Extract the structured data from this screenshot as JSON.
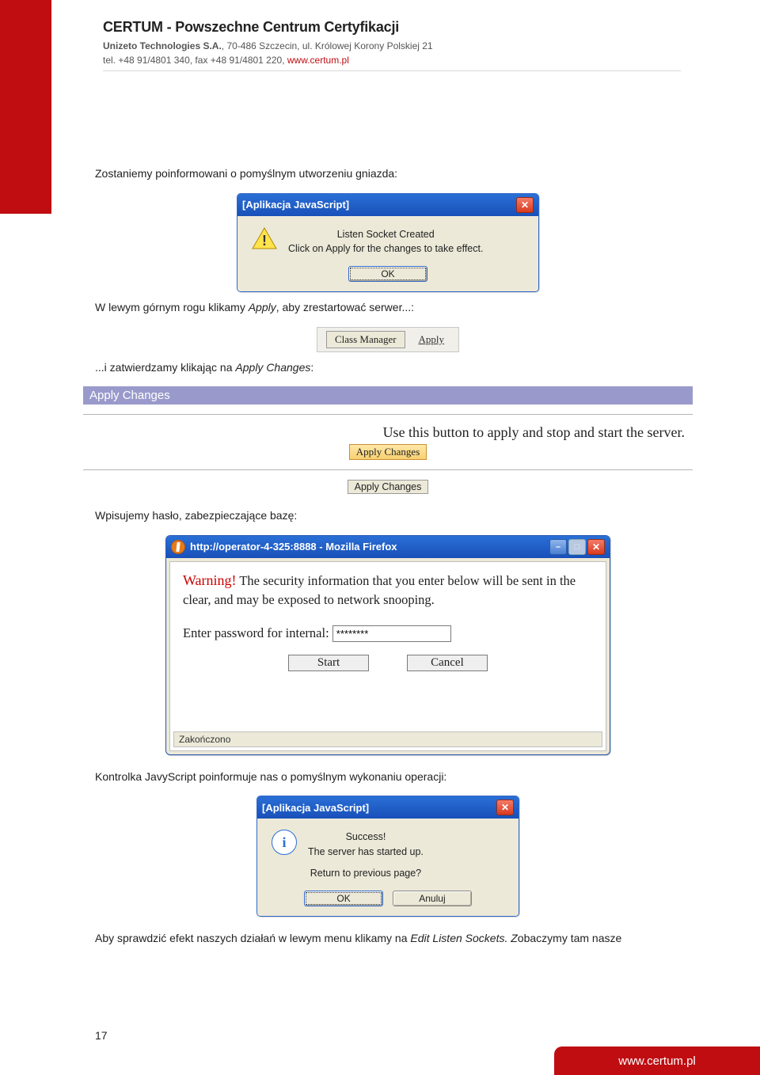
{
  "header": {
    "title": "CERTUM - Powszechne Centrum Certyfikacji",
    "line1_a": "Unizeto Technologies S.A.",
    "line1_b": ", 70-486 Szczecin, ul. Królowej Korony Polskiej 21",
    "line2_a": "tel. +48 91/4801 340, fax +48 91/4801 220, ",
    "line2_link": "www.certum.pl"
  },
  "body": {
    "p1": "Zostaniemy poinformowani o pomyślnym utworzeniu gniazda:",
    "p2_a": "W lewym górnym rogu klikamy ",
    "p2_i": "Apply",
    "p2_b": ", aby zrestartować serwer...:",
    "p3_a": "...i zatwierdzamy klikając na ",
    "p3_i": "Apply Changes",
    "p3_b": ":",
    "p4": "Wpisujemy hasło, zabezpieczające bazę:",
    "p5": "Kontrolka JavyScript poinformuje nas o pomyślnym wykonaniu operacji:",
    "p6_a": "Aby sprawdzić efekt naszych działań w lewym menu klikamy na ",
    "p6_i": "Edit Listen Sockets. Z",
    "p6_b": "obaczymy tam nasze"
  },
  "dialog1": {
    "title": "[Aplikacja JavaScript]",
    "line1": "Listen Socket Created",
    "line2": "Click on Apply for the changes to take effect.",
    "ok": "OK"
  },
  "toolbar": {
    "class_manager": "Class Manager",
    "apply": "Apply"
  },
  "apply_changes": {
    "banner": "Apply Changes",
    "text": "Use this button to apply and stop and start the server.",
    "btn1": "Apply Changes",
    "btn2": "Apply Changes"
  },
  "firefox": {
    "title": "http://operator-4-325:8888 - Mozilla Firefox",
    "warn_label": "Warning!",
    "warn_text": " The security information that you enter below will be sent in the clear, and may be exposed to network snooping.",
    "prompt": "Enter password for internal: ",
    "pw_value": "********",
    "start": "Start",
    "cancel": "Cancel",
    "status": "Zakończono"
  },
  "dialog2": {
    "title": "[Aplikacja JavaScript]",
    "line1": "Success!",
    "line2": "The server has started up.",
    "line3": "Return to previous page?",
    "ok": "OK",
    "cancel": "Anuluj"
  },
  "page_number": "17",
  "footer_url": "www.certum.pl"
}
